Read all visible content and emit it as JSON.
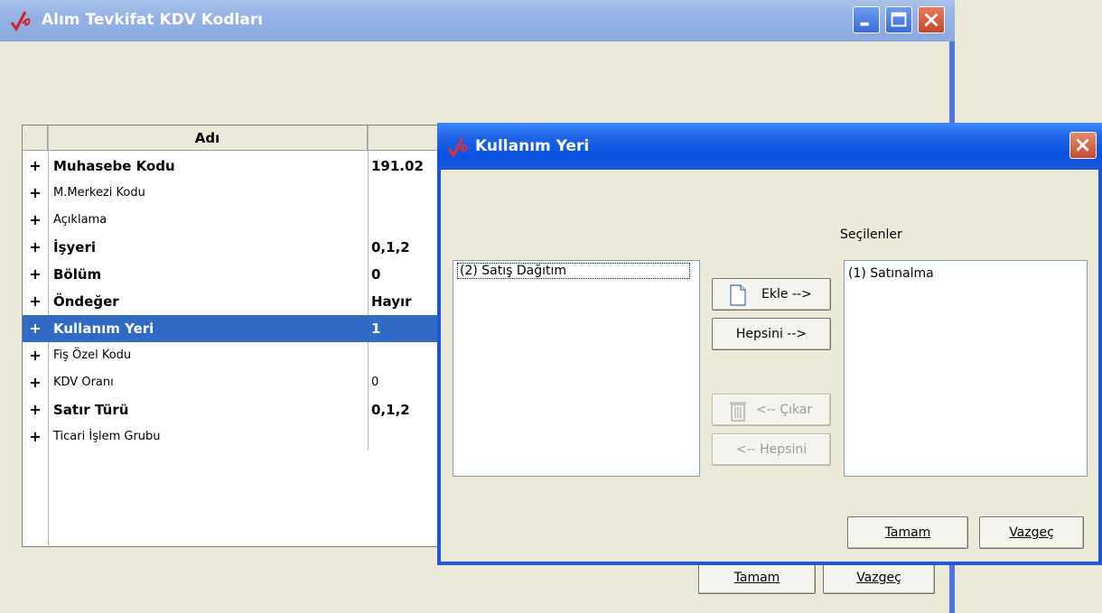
{
  "main_window": {
    "title": "Alım Tevkifat KDV Kodları",
    "grid": {
      "column_name_header": "Adı",
      "column_value_header": "",
      "rows": [
        {
          "expander": "+",
          "name": "Muhasebe Kodu",
          "value": "191.02",
          "bold": true
        },
        {
          "expander": "+",
          "name": "M.Merkezi Kodu",
          "value": "",
          "bold": false
        },
        {
          "expander": "+",
          "name": "Açıklama",
          "value": "",
          "bold": false
        },
        {
          "expander": "+",
          "name": "İşyeri",
          "value": "0,1,2",
          "bold": true
        },
        {
          "expander": "+",
          "name": "Bölüm",
          "value": "0",
          "bold": true
        },
        {
          "expander": "+",
          "name": "Öndeğer",
          "value": "Hayır",
          "bold": true
        },
        {
          "expander": "+",
          "name": "Kullanım Yeri",
          "value": "1",
          "bold": true,
          "selected": true
        },
        {
          "expander": "+",
          "name": "Fiş Özel Kodu",
          "value": "",
          "bold": false
        },
        {
          "expander": "+",
          "name": "KDV Oranı",
          "value": "0",
          "bold": false
        },
        {
          "expander": "+",
          "name": "Satır Türü",
          "value": "0,1,2",
          "bold": true
        },
        {
          "expander": "+",
          "name": "Ticari İşlem Grubu",
          "value": "",
          "bold": false
        }
      ]
    },
    "ok_label": "Tamam",
    "cancel_label": "Vazgeç"
  },
  "dialog": {
    "title": "Kullanım Yeri",
    "selected_list_label": "Seçilenler",
    "available_items": [
      "(2) Satış Dağıtım"
    ],
    "selected_items": [
      "(1) Satınalma"
    ],
    "add_label": "Ekle -->",
    "add_all_label": "Hepsini -->",
    "remove_label": "<-- Çıkar",
    "remove_all_label": "<-- Hepsini",
    "ok_label": "Tamam",
    "cancel_label": "Vazgeç"
  },
  "colors": {
    "selection": "#316AC5",
    "dialog_title": "#0952E0",
    "inactive_title": "#94B2E6",
    "window_bg": "#ECE9D8"
  }
}
